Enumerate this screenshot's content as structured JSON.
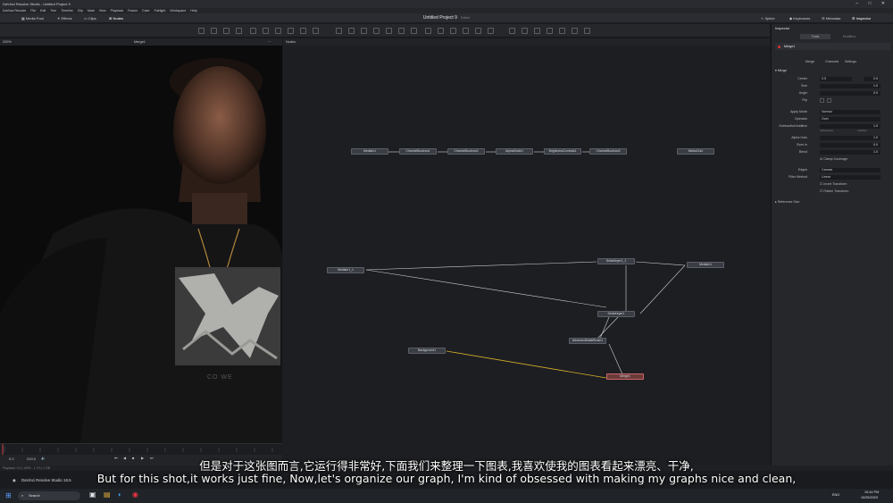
{
  "window": {
    "title": "DaVinci Resolve Studio - Untitled Project 9"
  },
  "menu": [
    "DaVinci Resolve",
    "File",
    "Edit",
    "Trim",
    "Timeline",
    "Clip",
    "Mark",
    "View",
    "Playback",
    "Fusion",
    "Color",
    "Fairlight",
    "Workspace",
    "Help"
  ],
  "topbar": {
    "left": [
      "Media Pool",
      "Effects",
      "Clips",
      "Nodes"
    ],
    "project_title": "Untitled Project 9",
    "edited": "Edited",
    "right": [
      "Spline",
      "Keyframes",
      "Metadata",
      "Inspector"
    ]
  },
  "viewer": {
    "zoom": "220%",
    "name": "Merge1"
  },
  "nodes_panel": {
    "label": "Nodes"
  },
  "nodes": [
    {
      "id": "n1",
      "label": "MediaIn1"
    },
    {
      "id": "n2",
      "label": "ChannelBoolean1"
    },
    {
      "id": "n3",
      "label": "ChannelBoolean2"
    },
    {
      "id": "n4",
      "label": "AlphaDivide1"
    },
    {
      "id": "n5",
      "label": "BrightnessContrast1"
    },
    {
      "id": "n6",
      "label": "ChannelBoolean3"
    },
    {
      "id": "n7",
      "label": "MediaOut1"
    },
    {
      "id": "n8",
      "label": "MediaIn1_1"
    },
    {
      "id": "n9",
      "label": "DeltaKeyer1_1"
    },
    {
      "id": "n10",
      "label": "MediaIn1"
    },
    {
      "id": "n11",
      "label": "DeltaKeyer1"
    },
    {
      "id": "n12",
      "label": "AdvancedMatteBrush1"
    },
    {
      "id": "n13",
      "label": "Background1"
    },
    {
      "id": "n14",
      "label": "Merge1"
    }
  ],
  "inspector": {
    "header": "Inspector",
    "tabs": [
      "Tools",
      "Modifiers"
    ],
    "node_name": "Merge1",
    "subtabs": [
      "Merge",
      "Channels",
      "Settings"
    ],
    "section": "Merge",
    "rows": [
      {
        "label": "Center",
        "x": "0.5",
        "value": "0.5"
      },
      {
        "label": "Size",
        "value": "1.0"
      },
      {
        "label": "Angle",
        "value": "0.0"
      },
      {
        "label": "Flip",
        "value": ""
      },
      {
        "label": "Apply Mode",
        "value": "Normal"
      },
      {
        "label": "Operator",
        "value": "Over"
      },
      {
        "label": "Subtractive/Additive",
        "value": "1.0"
      },
      {
        "label": "Alpha Gain",
        "value": "1.0"
      },
      {
        "label": "Burn In",
        "value": "0.0"
      },
      {
        "label": "Blend",
        "value": "1.0"
      }
    ],
    "sub_additive_labels": [
      "Subtractive",
      "Additive"
    ],
    "clamp_label": "Clamp Coverage",
    "edges_label": "Edges",
    "edges_value": "Canvas",
    "filter_label": "Filter Method",
    "filter_value": "Linear",
    "invert_label": "Invert Transform",
    "flatten_label": "Flatten Transform",
    "reference_label": "Reference Size"
  },
  "transport": {
    "frame_start": "0.0",
    "frame_end": "220.0"
  },
  "statusbar": {
    "text": "Playback: 0.0 | 100% - 1.7% | 1 GB"
  },
  "resolve_bar": {
    "app": "DaVinci Resolve Studio 18.5"
  },
  "taskbar": {
    "search": "Search",
    "time": "10:44 PM",
    "date": "10/25/2023",
    "lang": "ENG"
  },
  "subtitles": {
    "cn": "但是对于这张图而言,它运行得非常好,下面我们来整理一下图表,我喜欢使我的图表看起来漂亮、干净,",
    "en": "But for this shot,it works just fine, Now,let's organize our graph, I'm kind of obsessed with making my graphs nice and clean,"
  }
}
